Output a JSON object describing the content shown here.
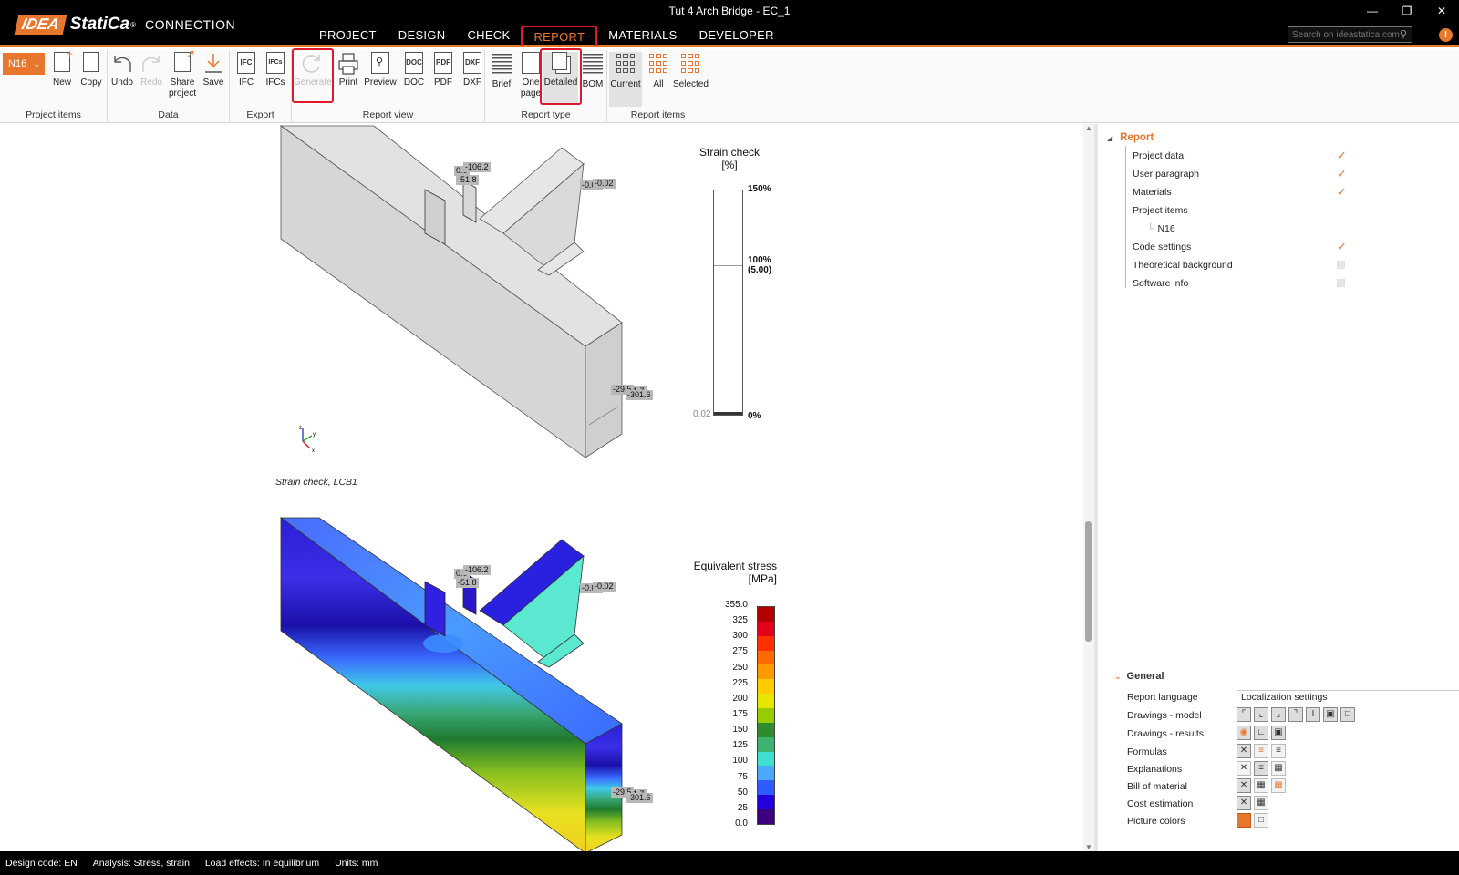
{
  "app": {
    "logo_idea": "IDEA",
    "logo_statica": "StatiCa",
    "logo_reg": "®",
    "logo_product": "CONNECTION",
    "document_title": "Tut 4 Arch Bridge - EC_1"
  },
  "nav": {
    "project": "PROJECT",
    "design": "DESIGN",
    "check": "CHECK",
    "report": "REPORT",
    "materials": "MATERIALS",
    "developer": "DEVELOPER"
  },
  "search": {
    "placeholder": "Search on ideastatica.com"
  },
  "ribbon": {
    "item_selector": "N16",
    "groups": {
      "project_items": "Project items",
      "data": "Data",
      "export": "Export",
      "report_view": "Report view",
      "report_type": "Report type",
      "report_items": "Report items"
    },
    "buttons": {
      "new": "New",
      "copy": "Copy",
      "undo": "Undo",
      "redo": "Redo",
      "share_1": "Share",
      "share_2": "project",
      "save": "Save",
      "ifc": "IFC",
      "ifcs": "IFCs",
      "generate": "Generate",
      "print": "Print",
      "preview": "Preview",
      "doc": "DOC",
      "pdf": "PDF",
      "dxf": "DXF",
      "brief": "Brief",
      "one_page_1": "One",
      "one_page_2": "page",
      "detailed": "Detailed",
      "bom": "BOM",
      "current": "Current",
      "all": "All",
      "selected": "Selected"
    },
    "icon_text": {
      "ifc": "IFC",
      "ifcs": "IFCs",
      "doc": "DOC",
      "pdf": "PDF",
      "dxf": "DXF"
    }
  },
  "report": {
    "figure1": {
      "legend_title_1": "Strain check",
      "legend_title_2": "[%]",
      "label_150": "150%",
      "label_100": "100%",
      "label_100b": "(5.00)",
      "label_0": "0%",
      "label_min": "0.02",
      "caption": "Strain check, LCB1",
      "tags": [
        "0.0",
        "-106.2",
        "-51.8",
        "-0.05",
        "-0.02",
        "-29.5",
        "1.7",
        "-301.6"
      ]
    },
    "figure2": {
      "legend_title_1": "Equivalent stress",
      "legend_title_2": "[MPa]",
      "scale": [
        "355.0",
        "325",
        "300",
        "275",
        "250",
        "225",
        "200",
        "175",
        "150",
        "125",
        "100",
        "75",
        "50",
        "25",
        "0.0"
      ],
      "colors": [
        "#b30000",
        "#e3001b",
        "#ff3000",
        "#ff6a00",
        "#ff9900",
        "#ffcc00",
        "#e6e600",
        "#99cc00",
        "#2e8b2e",
        "#3cb371",
        "#40e0d0",
        "#4aa8ff",
        "#2f5cff",
        "#2200dd",
        "#3a0080"
      ],
      "tags": [
        "0.0",
        "-106.2",
        "-51.8",
        "-0.05",
        "-0.02",
        "-29.5",
        "1.7",
        "-301.6"
      ]
    }
  },
  "tree": {
    "root": "Report",
    "items": [
      {
        "label": "Project data",
        "checked": true
      },
      {
        "label": "User paragraph",
        "checked": true
      },
      {
        "label": "Materials",
        "checked": true
      },
      {
        "label": "Project items",
        "checked": null
      },
      {
        "label": "N16",
        "checked": null
      },
      {
        "label": "Code settings",
        "checked": true
      },
      {
        "label": "Theoretical background",
        "checked": false
      },
      {
        "label": "Software info",
        "checked": false
      }
    ]
  },
  "general": {
    "heading": "General",
    "report_language_label": "Report language",
    "report_language_value": "Localization settings",
    "rows": {
      "drawings_model": "Drawings - model",
      "drawings_results": "Drawings - results",
      "formulas": "Formulas",
      "explanations": "Explanations",
      "bill_of_material": "Bill of material",
      "cost_estimation": "Cost estimation",
      "picture_colors": "Picture colors"
    }
  },
  "status": {
    "design_code": "Design code: EN",
    "analysis": "Analysis: Stress, strain",
    "load_effects": "Load effects: In equilibrium",
    "units": "Units: mm"
  },
  "colors": {
    "accent": "#e8772e",
    "highlight": "#e0182e"
  }
}
